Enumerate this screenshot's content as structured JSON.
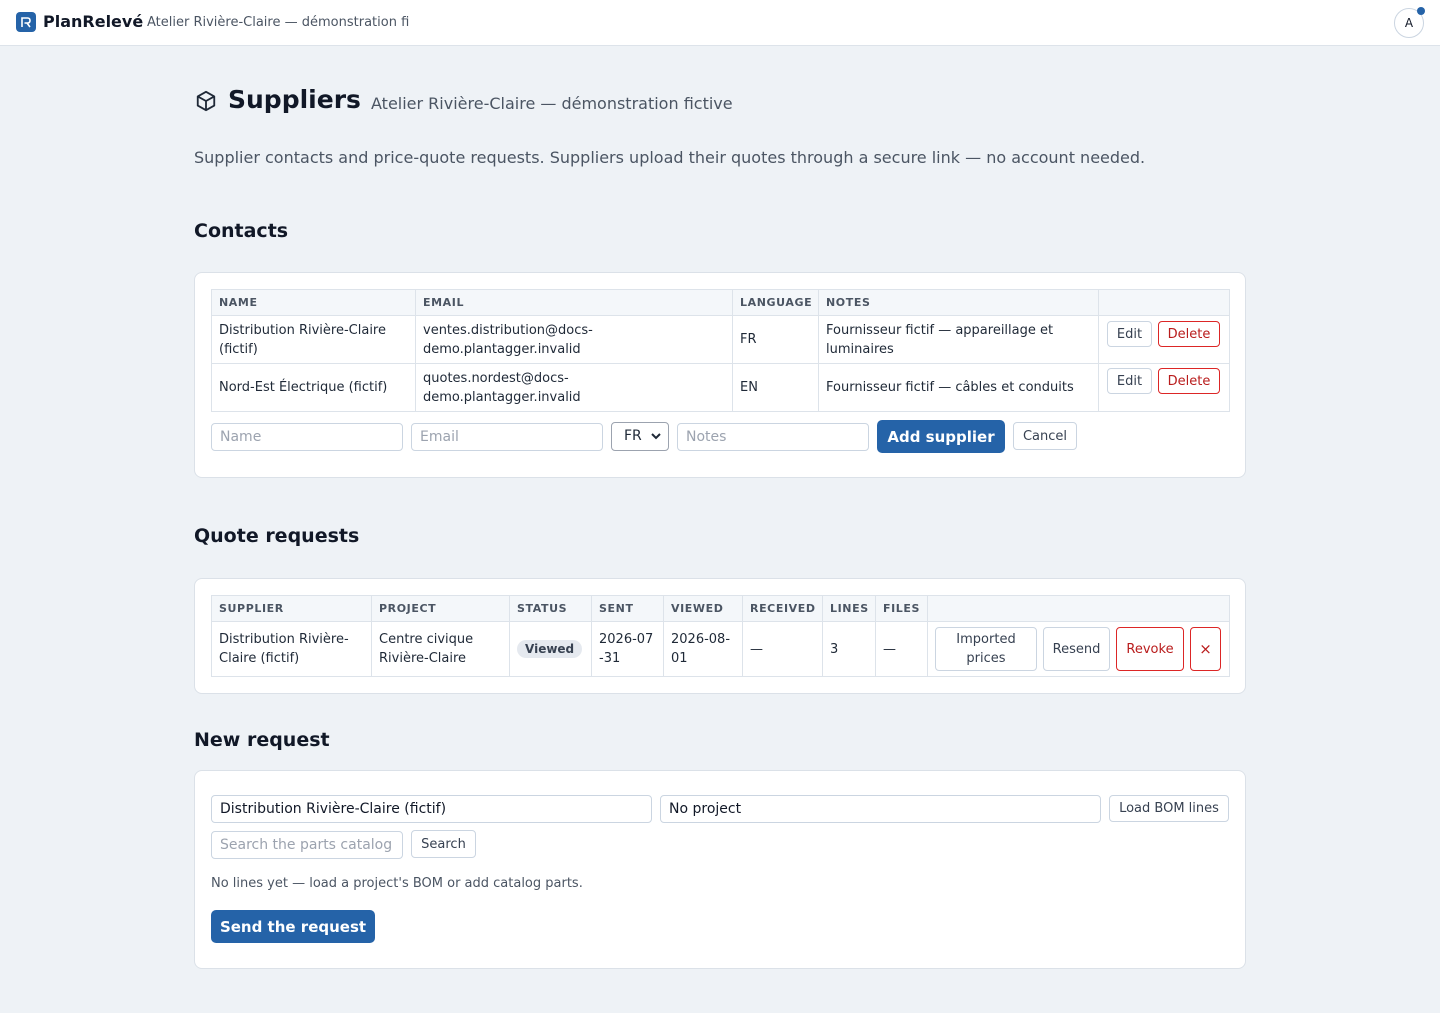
{
  "app": {
    "name": "PlanRelevé",
    "org_truncated": "Atelier Rivière-Claire — démonstration fictive",
    "avatar_initial": "A"
  },
  "page": {
    "title": "Suppliers",
    "org": "Atelier Rivière-Claire — démonstration fictive",
    "description": "Supplier contacts and price-quote requests. Suppliers upload their quotes through a secure link — no account needed."
  },
  "contacts": {
    "heading": "Contacts",
    "columns": [
      "NAME",
      "EMAIL",
      "LANGUAGE",
      "NOTES"
    ],
    "rows": [
      {
        "name": "Distribution Rivière-Claire (fictif)",
        "email": "ventes.distribution@docs-demo.plantagger.invalid",
        "language": "FR",
        "notes": "Fournisseur fictif — appareillage et luminaires"
      },
      {
        "name": "Nord-Est Électrique (fictif)",
        "email": "quotes.nordest@docs-demo.plantagger.invalid",
        "language": "EN",
        "notes": "Fournisseur fictif — câbles et conduits"
      }
    ],
    "row_actions": {
      "edit": "Edit",
      "delete": "Delete"
    },
    "form": {
      "name_placeholder": "Name",
      "email_placeholder": "Email",
      "language_value": "FR",
      "notes_placeholder": "Notes",
      "add_label": "Add supplier",
      "cancel_label": "Cancel"
    }
  },
  "quotes": {
    "heading": "Quote requests",
    "columns": [
      "SUPPLIER",
      "PROJECT",
      "STATUS",
      "SENT",
      "VIEWED",
      "RECEIVED",
      "LINES",
      "FILES"
    ],
    "rows": [
      {
        "supplier": "Distribution Rivière-Claire (fictif)",
        "project": "Centre civique Rivière-Claire",
        "status": "Viewed",
        "sent": "2026-07-31",
        "viewed": "2026-08-01",
        "received": "—",
        "lines": "3",
        "files": "—"
      }
    ],
    "row_actions": {
      "imported_prices": "Imported prices",
      "resend": "Resend",
      "revoke": "Revoke",
      "remove": "×"
    }
  },
  "new_request": {
    "heading": "New request",
    "supplier_value": "Distribution Rivière-Claire (fictif)",
    "project_value": "No project",
    "load_bom_label": "Load BOM lines",
    "search_placeholder": "Search the parts catalog",
    "search_label": "Search",
    "empty_note": "No lines yet — load a project's BOM or add catalog parts.",
    "send_label": "Send the request"
  },
  "colors": {
    "accent": "#2563a8",
    "danger": "#b91c1c",
    "background": "#eef2f6"
  },
  "icons": [
    "app-logo-icon",
    "package-icon",
    "chevron-down-icon",
    "notification-dot"
  ]
}
